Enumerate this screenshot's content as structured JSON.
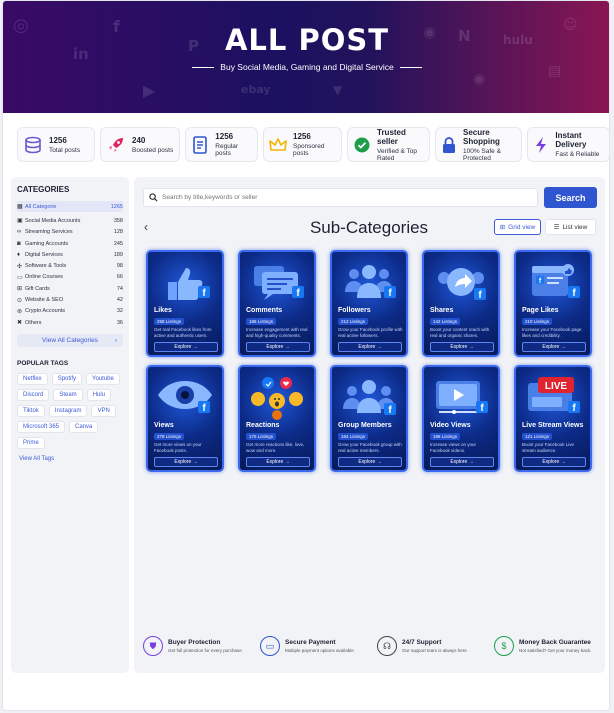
{
  "header": {
    "title": "ALL POST",
    "subtitle": "Buy Social Media, Gaming and Digital Service"
  },
  "stats": [
    {
      "value": "1256",
      "label": "Total posts",
      "icon": "database-icon",
      "color": "#6a5acd"
    },
    {
      "value": "240",
      "label": "Boosted posts",
      "icon": "rocket-icon",
      "color": "#e0245e"
    },
    {
      "value": "1256",
      "label": "Regular posts",
      "icon": "document-icon",
      "color": "#2f56d0"
    },
    {
      "value": "1256",
      "label": "Sponsored posts",
      "icon": "crown-icon",
      "color": "#f4b400"
    },
    {
      "value": "Trusted seller",
      "label": "Verified & Top Rated",
      "icon": "verified-badge-icon",
      "color": "#1e9e4a"
    },
    {
      "value": "Secure Shopping",
      "label": "100% Safe & Protected",
      "icon": "lock-icon",
      "color": "#2f56d0"
    },
    {
      "value": "Instant Delivery",
      "label": "Fast & Reliable",
      "icon": "lightning-icon",
      "color": "#7b3fe4"
    }
  ],
  "sidebar": {
    "heading": "CATEGORIES",
    "categories": [
      {
        "name": "All Categorie",
        "count": "1265",
        "icon": "grid-icon"
      },
      {
        "name": "Social Media Accounts",
        "count": "358",
        "icon": "users-icon"
      },
      {
        "name": "Streaming Services",
        "count": "128",
        "icon": "play-icon"
      },
      {
        "name": "Gaming Accounts",
        "count": "245",
        "icon": "gamepad-icon"
      },
      {
        "name": "Digital Services",
        "count": "189",
        "icon": "bulb-icon"
      },
      {
        "name": "Software & Tools",
        "count": "98",
        "icon": "gear-icon"
      },
      {
        "name": "Online Courses",
        "count": "66",
        "icon": "book-icon"
      },
      {
        "name": "Gift Cards",
        "count": "74",
        "icon": "gift-icon"
      },
      {
        "name": "Website & SEO",
        "count": "42",
        "icon": "globe-icon"
      },
      {
        "name": "Crypto Accounts",
        "count": "32",
        "icon": "coin-icon"
      },
      {
        "name": "Others",
        "count": "36",
        "icon": "close-icon"
      }
    ],
    "view_all": "View All Categories",
    "tags_heading": "POPULAR TAGS",
    "tags": [
      "Netflex",
      "Spotify",
      "Youtube",
      "Discord",
      "Steam",
      "Hulu",
      "Tiktok",
      "Instagram",
      "VPN",
      "Microsoft 365",
      "Canva",
      "Prime"
    ],
    "view_tags": "View All Tags"
  },
  "search": {
    "placeholder": "Search by title,keywords or seller",
    "button": "Search"
  },
  "main": {
    "heading": "Sub-Categories",
    "grid_view": "Grid view",
    "list_view": "List view",
    "explore": "Explore →",
    "cards": [
      {
        "name": "Likes",
        "listings": "258 Listings",
        "desc": "Get real Facebook likes from active and authentic users.",
        "icon": "thumbs-up-icon"
      },
      {
        "name": "Comments",
        "listings": "186 Listings",
        "desc": "Increase engagement with real and high-quality comments.",
        "icon": "comment-icon"
      },
      {
        "name": "Followers",
        "listings": "212 Listings",
        "desc": "Grow your Facebook profile with real active followers.",
        "icon": "followers-icon"
      },
      {
        "name": "Shares",
        "listings": "142 Listings",
        "desc": "Boost your content reach with real and organic shares.",
        "icon": "share-icon"
      },
      {
        "name": "Page Likes",
        "listings": "210 Listings",
        "desc": "Increase your Facebook page likes and credibility.",
        "icon": "page-like-icon"
      },
      {
        "name": "Views",
        "listings": "278 Listings",
        "desc": "Get more views on your Facebook posts.",
        "icon": "eye-icon"
      },
      {
        "name": "Reactions",
        "listings": "175 Listings",
        "desc": "Get more reactions like, love, wow and more.",
        "icon": "reactions-icon"
      },
      {
        "name": "Group Members",
        "listings": "164 Listings",
        "desc": "Grow your Facebook group with real active members.",
        "icon": "group-icon"
      },
      {
        "name": "Video Views",
        "listings": "198 Listings",
        "desc": "Increase views on your Facebook videos.",
        "icon": "video-icon"
      },
      {
        "name": "Live Stream Views",
        "listings": "121 Listings",
        "desc": "Boost your Facebook Live stream audience.",
        "icon": "live-icon",
        "live_label": "LIVE"
      }
    ]
  },
  "features": [
    {
      "title": "Buyer Protection",
      "desc": "Get full protection for every purchase",
      "icon": "shield-icon",
      "color": "#7b3fe4"
    },
    {
      "title": "Secure Payment",
      "desc": "Multiple payment options available",
      "icon": "card-icon",
      "color": "#2f56d0"
    },
    {
      "title": "24/7 Support",
      "desc": "Our support team is always here",
      "icon": "headset-icon",
      "color": "#444444"
    },
    {
      "title": "Money Back Guarantee",
      "desc": "Not satisfied? Get your money back.",
      "icon": "money-back-icon",
      "color": "#1e9e4a"
    }
  ]
}
